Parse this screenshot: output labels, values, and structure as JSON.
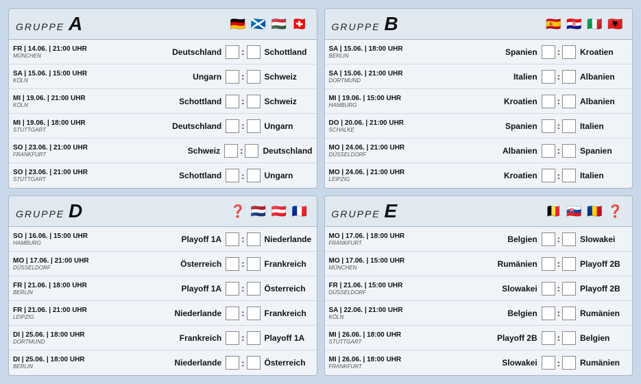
{
  "groups": [
    {
      "id": "A",
      "label": "GRUPPE",
      "letter": "A",
      "flags": [
        "🇩🇪",
        "🏴󠁧󠁢󠁳󠁣󠁴󠁿",
        "🇭🇺",
        "🇨🇭"
      ],
      "matches": [
        {
          "day": "FR | 14.06.",
          "time": "21:00 UHR",
          "venue": "MÜNCHEN",
          "home": "Deutschland",
          "away": "Schottland"
        },
        {
          "day": "SA | 15.06.",
          "time": "15:00 UHR",
          "venue": "KÖLN",
          "home": "Ungarn",
          "away": "Schweiz"
        },
        {
          "day": "MI | 19.06.",
          "time": "21:00 UHR",
          "venue": "KÖLN",
          "home": "Schottland",
          "away": "Schweiz"
        },
        {
          "day": "MI | 19.06.",
          "time": "18:00 UHR",
          "venue": "STUTTGART",
          "home": "Deutschland",
          "away": "Ungarn"
        },
        {
          "day": "SO | 23.06.",
          "time": "21:00 UHR",
          "venue": "FRANKFURT",
          "home": "Schweiz",
          "away": "Deutschland"
        },
        {
          "day": "SO | 23.06.",
          "time": "21:00 UHR",
          "venue": "STUTTGART",
          "home": "Schottland",
          "away": "Ungarn"
        }
      ]
    },
    {
      "id": "B",
      "label": "GRUPPE",
      "letter": "B",
      "flags": [
        "🇪🇸",
        "🇭🇷",
        "🇮🇹",
        "🇦🇱"
      ],
      "matches": [
        {
          "day": "SA | 15.06.",
          "time": "18:00 UHR",
          "venue": "BERLIN",
          "home": "Spanien",
          "away": "Kroatien"
        },
        {
          "day": "SA | 15.06.",
          "time": "21:00 UHR",
          "venue": "DORTMUND",
          "home": "Italien",
          "away": "Albanien"
        },
        {
          "day": "MI | 19.06.",
          "time": "15:00 UHR",
          "venue": "HAMBURG",
          "home": "Kroatien",
          "away": "Albanien"
        },
        {
          "day": "DO | 20.06.",
          "time": "21:00 UHR",
          "venue": "SCHALKE",
          "home": "Spanien",
          "away": "Italien"
        },
        {
          "day": "MO | 24.06.",
          "time": "21:00 UHR",
          "venue": "DÜSSELDORF",
          "home": "Albanien",
          "away": "Spanien"
        },
        {
          "day": "MO | 24.06.",
          "time": "21:00 UHR",
          "venue": "LEIPZIG",
          "home": "Kroatien",
          "away": "Italien"
        }
      ]
    },
    {
      "id": "D",
      "label": "GRUPPE",
      "letter": "D",
      "flags": [
        "❓",
        "🇳🇱",
        "🇦🇹",
        "🇫🇷"
      ],
      "matches": [
        {
          "day": "SO | 16.06.",
          "time": "15:00 UHR",
          "venue": "HAMBURG",
          "home": "Playoff 1A",
          "away": "Niederlande"
        },
        {
          "day": "MO | 17.06.",
          "time": "21:00 UHR",
          "venue": "DÜSSELDORF",
          "home": "Österreich",
          "away": "Frankreich"
        },
        {
          "day": "FR | 21.06.",
          "time": "18:00 UHR",
          "venue": "BERLIN",
          "home": "Playoff 1A",
          "away": "Österreich"
        },
        {
          "day": "FR | 21.06.",
          "time": "21:00 UHR",
          "venue": "LEIPZIG",
          "home": "Niederlande",
          "away": "Frankreich"
        },
        {
          "day": "DI | 25.06.",
          "time": "18:00 UHR",
          "venue": "DORTMUND",
          "home": "Frankreich",
          "away": "Playoff 1A"
        },
        {
          "day": "DI | 25.06.",
          "time": "18:00 UHR",
          "venue": "BERLIN",
          "home": "Niederlande",
          "away": "Österreich"
        }
      ]
    },
    {
      "id": "E",
      "label": "GRUPPE",
      "letter": "E",
      "flags": [
        "🇧🇪",
        "🇸🇰",
        "🇷🇴",
        "❓"
      ],
      "matches": [
        {
          "day": "MO | 17.06.",
          "time": "18:00 UHR",
          "venue": "FRANKFURT",
          "home": "Belgien",
          "away": "Slowakei"
        },
        {
          "day": "MO | 17.06.",
          "time": "15:00 UHR",
          "venue": "MÜNCHEN",
          "home": "Rumänien",
          "away": "Playoff 2B"
        },
        {
          "day": "FR | 21.06.",
          "time": "15:00 UHR",
          "venue": "DÜSSELDORF",
          "home": "Slowakei",
          "away": "Playoff 2B"
        },
        {
          "day": "SA | 22.06.",
          "time": "21:00 UHR",
          "venue": "KÖLN",
          "home": "Belgien",
          "away": "Rumänien"
        },
        {
          "day": "MI | 26.06.",
          "time": "18:00 UHR",
          "venue": "STUTTGART",
          "home": "Playoff 2B",
          "away": "Belgien"
        },
        {
          "day": "MI | 26.06.",
          "time": "18:00 UHR",
          "venue": "FRANKFURT",
          "home": "Slowakei",
          "away": "Rumänien"
        }
      ]
    }
  ]
}
